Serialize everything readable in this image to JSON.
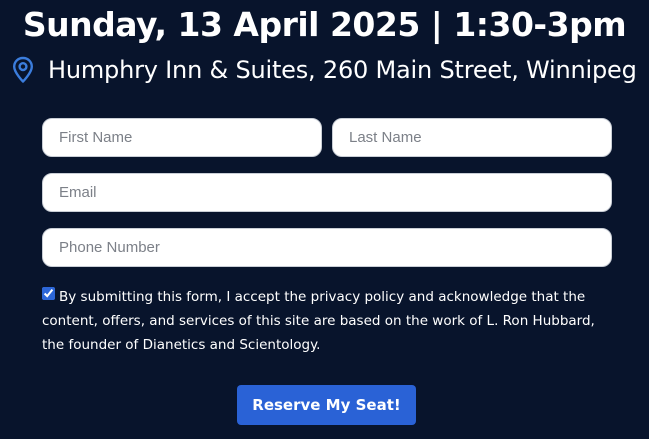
{
  "event": {
    "date_time": "Sunday, 13 April 2025 | 1:30-3pm",
    "location": "Humphry Inn & Suites, 260 Main Street, Winnipeg",
    "location_icon": "map-pin-icon"
  },
  "form": {
    "first_name": {
      "placeholder": "First Name",
      "value": ""
    },
    "last_name": {
      "placeholder": "Last Name",
      "value": ""
    },
    "email": {
      "placeholder": "Email",
      "value": ""
    },
    "phone": {
      "placeholder": "Phone Number",
      "value": ""
    },
    "consent": {
      "checked": true,
      "text": "By submitting this form, I accept the privacy policy and acknowledge that the content, offers, and services of this site are based on the work of L. Ron Hubbard, the founder of Dianetics and Scientology."
    },
    "submit_label": "Reserve My Seat!"
  },
  "colors": {
    "background": "#08142c",
    "accent": "#2a62d6",
    "text": "#ffffff"
  }
}
